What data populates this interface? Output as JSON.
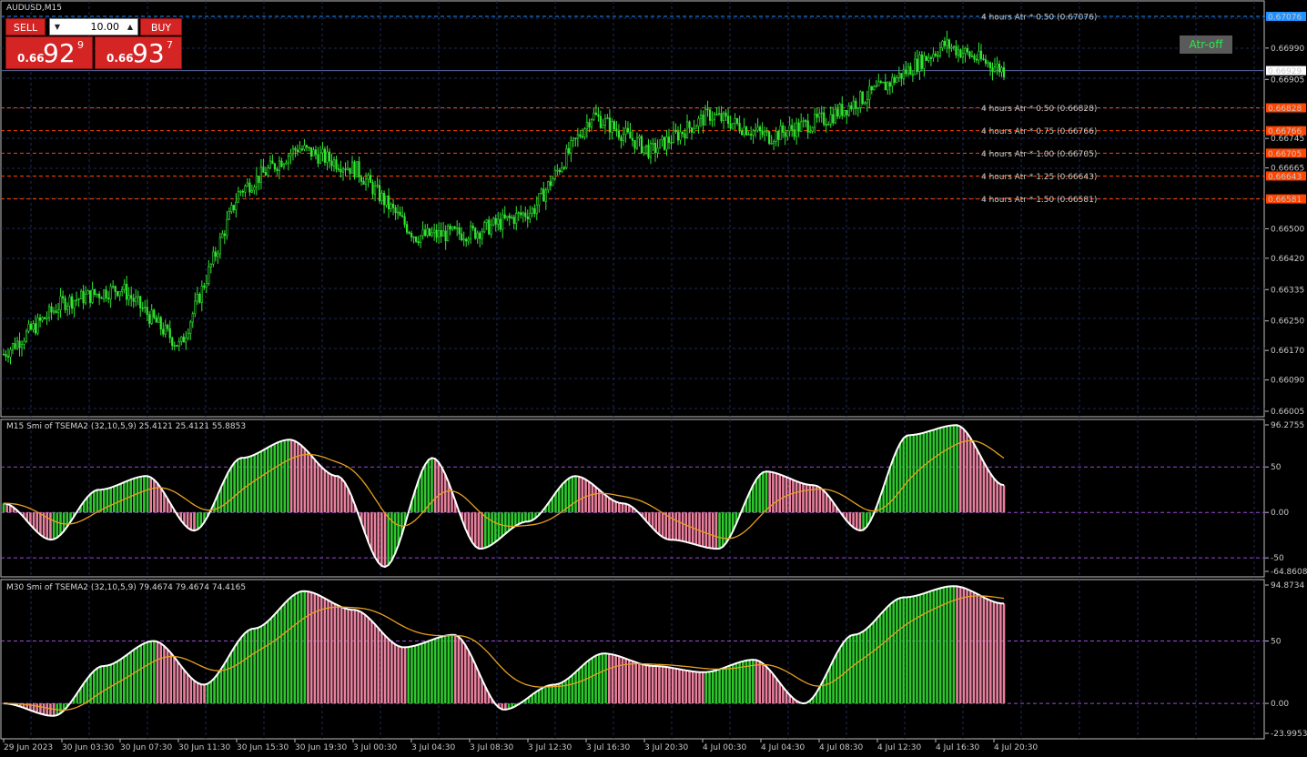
{
  "symbol_title": "AUDUSD,M15",
  "trade_panel": {
    "sell_label": "SELL",
    "buy_label": "BUY",
    "lot_value": "10.00",
    "sell_price_prefix": "0.66",
    "sell_price_big": "92",
    "sell_price_sup": "9",
    "buy_price_prefix": "0.66",
    "buy_price_big": "93",
    "buy_price_sup": "7"
  },
  "atr_button_label": "Atr-off",
  "atr_levels": [
    {
      "label": "4 hours Atr * 0.50 (0.67076)",
      "tag": "0.67076",
      "color": "#1e90ff"
    },
    {
      "label": "4 hours Atr * 0.50 (0.66828)",
      "tag": "0.66828",
      "color": "#ff4500"
    },
    {
      "label": "4 hours Atr * 0.75 (0.66766)",
      "tag": "0.66766",
      "color": "#ff4500"
    },
    {
      "label": "4 hours Atr * 1.00 (0.66705)",
      "tag": "0.66705",
      "color": "#ff4500"
    },
    {
      "label": "4 hours Atr * 1.25 (0.66643)",
      "tag": "0.66643",
      "color": "#ff4500"
    },
    {
      "label": "4 hours Atr * 1.50 (0.66581)",
      "tag": "0.66581",
      "color": "#ff4500"
    }
  ],
  "current_price_tag": "0.66929",
  "price_axis_labels": [
    "0.66990",
    "0.66905",
    "0.66745",
    "0.66665",
    "0.66500",
    "0.66420",
    "0.66335",
    "0.66250",
    "0.66170",
    "0.66090",
    "0.66005"
  ],
  "indicator1": {
    "title": "M15 Smi of TSEMA2 (32,10,5,9) 25.4121 25.4121 55.8853",
    "axis_labels": [
      "96.2755",
      "50",
      "0.00",
      "-50",
      "-64.8608"
    ]
  },
  "indicator2": {
    "title": "M30 Smi of TSEMA2 (32,10,5,9) 79.4674 79.4674 74.4165",
    "axis_labels": [
      "94.8734",
      "50",
      "0.00",
      "-23.9953"
    ]
  },
  "time_axis_labels": [
    "29 Jun 2023",
    "30 Jun 03:30",
    "30 Jun 07:30",
    "30 Jun 11:30",
    "30 Jun 15:30",
    "30 Jun 19:30",
    "3 Jul 00:30",
    "3 Jul 04:30",
    "3 Jul 08:30",
    "3 Jul 12:30",
    "3 Jul 16:30",
    "3 Jul 20:30",
    "4 Jul 00:30",
    "4 Jul 04:30",
    "4 Jul 08:30",
    "4 Jul 12:30",
    "4 Jul 16:30",
    "4 Jul 20:30"
  ],
  "chart_data": {
    "type": "candlestick",
    "timeframe": "M15",
    "price_range": [
      0.66005,
      0.67076
    ],
    "close_path": [
      {
        "t": "29 Jun 2023",
        "close": 0.6616
      },
      {
        "t": "30 Jun 03:30",
        "close": 0.663
      },
      {
        "t": "30 Jun 07:30",
        "close": 0.6634
      },
      {
        "t": "30 Jun 11:30",
        "close": 0.6618
      },
      {
        "t": "30 Jun 15:30",
        "close": 0.666
      },
      {
        "t": "30 Jun 19:30",
        "close": 0.6672
      },
      {
        "t": "3 Jul 00:30",
        "close": 0.6666
      },
      {
        "t": "3 Jul 04:30",
        "close": 0.6648
      },
      {
        "t": "3 Jul 08:30",
        "close": 0.6649
      },
      {
        "t": "3 Jul 12:30",
        "close": 0.6655
      },
      {
        "t": "3 Jul 16:30",
        "close": 0.6681
      },
      {
        "t": "3 Jul 20:30",
        "close": 0.6671
      },
      {
        "t": "4 Jul 00:30",
        "close": 0.6681
      },
      {
        "t": "4 Jul 04:30",
        "close": 0.6675
      },
      {
        "t": "4 Jul 08:30",
        "close": 0.668
      },
      {
        "t": "4 Jul 12:30",
        "close": 0.6689
      },
      {
        "t": "4 Jul 16:30",
        "close": 0.67
      },
      {
        "t": "4 Jul 20:30",
        "close": 0.6693
      }
    ],
    "smi_m15": [
      10,
      -30,
      25,
      40,
      -20,
      60,
      80,
      40,
      -60,
      60,
      -40,
      -10,
      40,
      10,
      -30,
      -40,
      45,
      30,
      -20,
      85,
      96,
      30
    ],
    "smi_m30": [
      0,
      -10,
      30,
      50,
      15,
      60,
      90,
      75,
      45,
      55,
      -5,
      15,
      40,
      30,
      25,
      35,
      0,
      55,
      85,
      94,
      80
    ]
  }
}
